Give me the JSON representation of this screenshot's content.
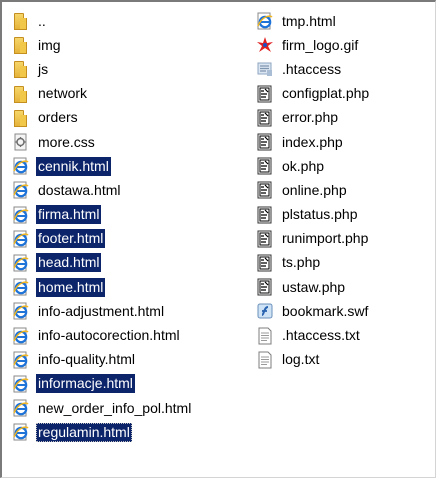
{
  "left_column": [
    {
      "name": "..",
      "type": "folder",
      "selected": false
    },
    {
      "name": "img",
      "type": "folder",
      "selected": false
    },
    {
      "name": "js",
      "type": "folder",
      "selected": false
    },
    {
      "name": "network",
      "type": "folder",
      "selected": false
    },
    {
      "name": "orders",
      "type": "folder",
      "selected": false
    },
    {
      "name": "more.css",
      "type": "css",
      "selected": false
    },
    {
      "name": "cennik.html",
      "type": "html",
      "selected": true
    },
    {
      "name": "dostawa.html",
      "type": "html",
      "selected": false
    },
    {
      "name": "firma.html",
      "type": "html",
      "selected": true
    },
    {
      "name": "footer.html",
      "type": "html",
      "selected": true
    },
    {
      "name": "head.html",
      "type": "html",
      "selected": true
    },
    {
      "name": "home.html",
      "type": "html",
      "selected": true
    },
    {
      "name": "info-adjustment.html",
      "type": "html",
      "selected": false
    },
    {
      "name": "info-autocorection.html",
      "type": "html",
      "selected": false
    },
    {
      "name": "info-quality.html",
      "type": "html",
      "selected": false
    },
    {
      "name": "informacje.html",
      "type": "html",
      "selected": true
    },
    {
      "name": "new_order_info_pol.html",
      "type": "html",
      "selected": false
    },
    {
      "name": "regulamin.html",
      "type": "html",
      "selected": true,
      "focused": true
    }
  ],
  "right_column": [
    {
      "name": "tmp.html",
      "type": "html",
      "selected": false
    },
    {
      "name": "firm_logo.gif",
      "type": "gif",
      "selected": false
    },
    {
      "name": ".htaccess",
      "type": "htaccess",
      "selected": false
    },
    {
      "name": "configplat.php",
      "type": "php",
      "selected": false
    },
    {
      "name": "error.php",
      "type": "php",
      "selected": false
    },
    {
      "name": "index.php",
      "type": "php",
      "selected": false
    },
    {
      "name": "ok.php",
      "type": "php",
      "selected": false
    },
    {
      "name": "online.php",
      "type": "php",
      "selected": false
    },
    {
      "name": "plstatus.php",
      "type": "php",
      "selected": false
    },
    {
      "name": "runimport.php",
      "type": "php",
      "selected": false
    },
    {
      "name": "ts.php",
      "type": "php",
      "selected": false
    },
    {
      "name": "ustaw.php",
      "type": "php",
      "selected": false
    },
    {
      "name": "bookmark.swf",
      "type": "swf",
      "selected": false
    },
    {
      "name": ".htaccess.txt",
      "type": "txt",
      "selected": false
    },
    {
      "name": "log.txt",
      "type": "txt",
      "selected": false
    }
  ],
  "colors": {
    "selection_bg": "#0b246a",
    "selection_text": "#ffffff",
    "folder": "#f2c84b"
  },
  "icons": {
    "folder": "folder-icon",
    "html": "html-file-icon",
    "css": "css-file-icon",
    "php": "php-file-icon",
    "gif": "image-file-icon",
    "swf": "flash-file-icon",
    "txt": "text-file-icon",
    "htaccess": "config-file-icon"
  }
}
